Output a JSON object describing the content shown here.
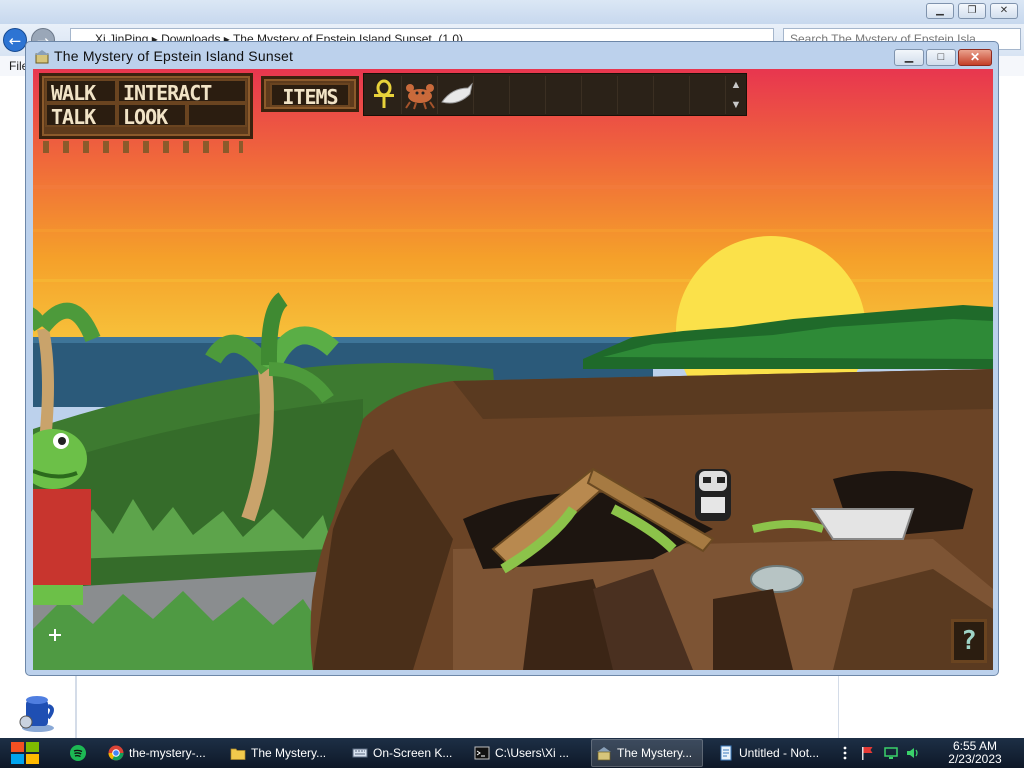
{
  "explorer": {
    "address_path": [
      "Xi JinPing",
      "Downloads",
      "The Mystery of Epstein Island Sunset_(1.0)"
    ],
    "search_placeholder": "Search The Mystery of Epstein Isla...",
    "menu_label": "File"
  },
  "game_window": {
    "title": "The Mystery of Epstein Island Sunset"
  },
  "verbs": {
    "walk": "WALK",
    "interact": "INTERACT",
    "talk": "TALK",
    "look": "LOOK"
  },
  "items_button": "ITEMS",
  "inventory": {
    "items": [
      "ankh-icon",
      "crab-icon",
      "fish-icon"
    ]
  },
  "help_button": "?",
  "taskbar": {
    "items": [
      {
        "label": "the-mystery-...",
        "icon": "chrome-icon",
        "active": false
      },
      {
        "label": "The Mystery...",
        "icon": "folder-icon",
        "active": false
      },
      {
        "label": "On-Screen K...",
        "icon": "keyboard-icon",
        "active": false
      },
      {
        "label": "C:\\Users\\Xi ...",
        "icon": "cmd-icon",
        "active": false
      },
      {
        "label": "The Mystery...",
        "icon": "game-icon",
        "active": true
      },
      {
        "label": "Untitled - Not...",
        "icon": "notepad-icon",
        "active": false
      }
    ],
    "time": "6:55 AM",
    "date": "2/23/2023"
  },
  "colors": {
    "sky_top": "#e8364f",
    "sky_bottom": "#f5a623",
    "sun": "#fbe14a",
    "sea": "#2b5a7a",
    "grass": "#3d7a30",
    "dirt": "#6b4426"
  }
}
